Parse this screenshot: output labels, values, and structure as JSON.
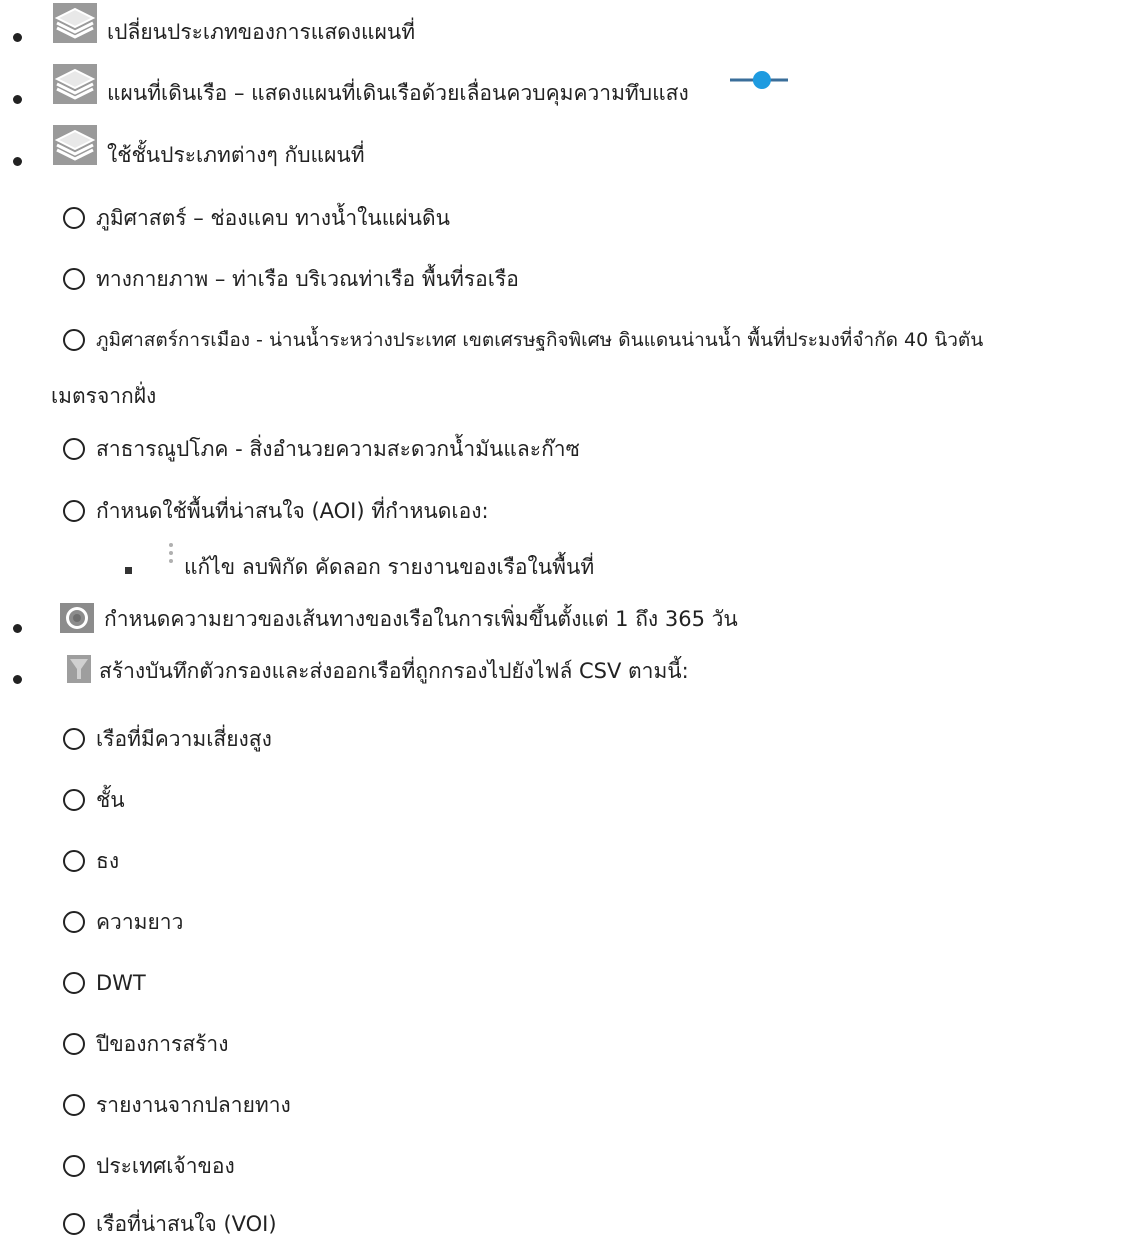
{
  "list": {
    "item1": {
      "text": "เปลี่ยนประเภทของการแสดงแผนที่",
      "icon": "layers-icon"
    },
    "item2": {
      "text": "แผนที่เดินเรือ – แสดงแผนที่เดินเรือด้วยเลื่อนควบคุมความทึบแสง",
      "icon": "layers-icon",
      "slider_icon": "opacity-slider-icon",
      "slider_value": 0.55
    },
    "item3": {
      "text": "ใช้ชั้นประเภทต่างๆ กับแผนที่",
      "icon": "layers-icon",
      "subitems": [
        {
          "text": "ภูมิศาสตร์ – ช่องแคบ ทางน้ำในแผ่นดิน"
        },
        {
          "text": "ทางกายภาพ – ท่าเรือ บริเวณท่าเรือ พื้นที่รอเรือ"
        },
        {
          "text": "ภูมิศาสตร์การเมือง - น่านน้ำระหว่างประเทศ เขตเศรษฐกิจพิเศษ ดินแดนน่านน้ำ พื้นที่ประมงที่จำกัด 40 นิวตัน",
          "text2": "เมตรจากฝั่ง"
        },
        {
          "text": "สาธารณูปโภค - สิ่งอำนวยความสะดวกน้ำมันและก๊าซ"
        },
        {
          "text": "กำหนดใช้พื้นที่น่าสนใจ (AOI) ที่กำหนดเอง:"
        }
      ],
      "nested": {
        "text": "แก้ไข ลบพิกัด คัดลอก รายงานของเรือในพื้นที่",
        "icon": "more-vertical-icon"
      }
    },
    "item4": {
      "text": "กำหนดความยาวของเส้นทางของเรือในการเพิ่มขึ้นตั้งแต่ 1 ถึง 365 วัน",
      "icon": "track-target-icon"
    },
    "item5": {
      "text": "สร้างบันทึกตัวกรองและส่งออกเรือที่ถูกกรองไปยังไฟล์ CSV ตามนี้:",
      "icon": "filter-icon",
      "subitems": [
        {
          "text": "เรือที่มีความเสี่ยงสูง"
        },
        {
          "text": "ชั้น"
        },
        {
          "text": "ธง"
        },
        {
          "text": "ความยาว"
        },
        {
          "text": "DWT"
        },
        {
          "text": "ปีของการสร้าง"
        },
        {
          "text": "รายงานจากปลายทาง"
        },
        {
          "text": "ประเทศเจ้าของ"
        },
        {
          "text": "เรือที่น่าสนใจ (VOI)"
        }
      ]
    }
  },
  "colors": {
    "text": "#222222",
    "icon_gray": "#8a8a8a",
    "icon_light": "#c9c9c9",
    "slider_blue": "#1e9be0",
    "slider_track": "#3a6e9a"
  }
}
